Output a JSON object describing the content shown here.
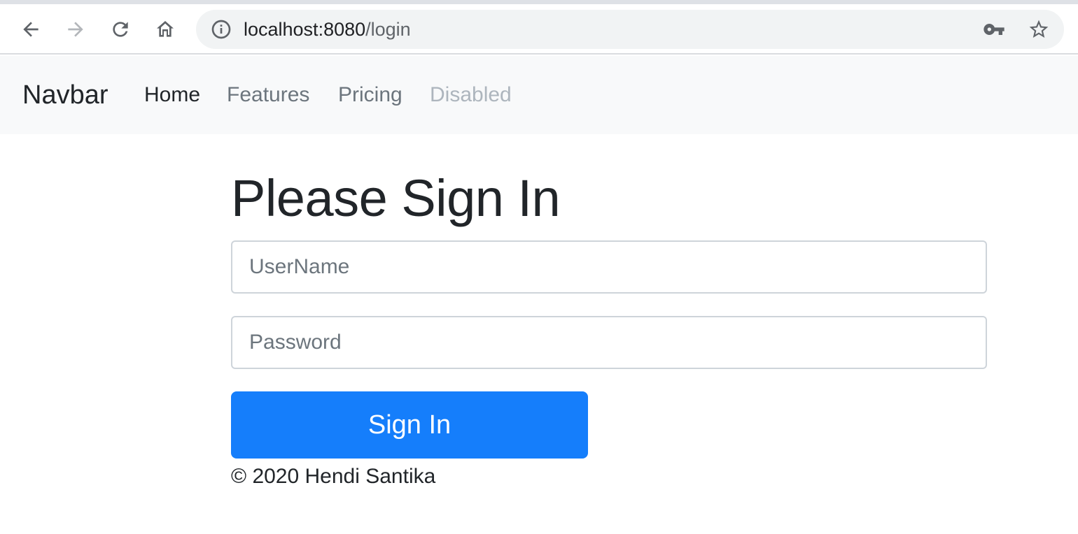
{
  "browser": {
    "url_host": "localhost:8080",
    "url_path": "/login",
    "icons": {
      "back": "arrow-left-icon",
      "forward": "arrow-right-icon",
      "reload": "reload-icon",
      "home": "home-icon",
      "site_info": "info-icon",
      "passwords": "key-icon",
      "bookmark": "star-icon"
    }
  },
  "navbar": {
    "brand": "Navbar",
    "links": [
      {
        "label": "Home",
        "state": "active"
      },
      {
        "label": "Features",
        "state": "normal"
      },
      {
        "label": "Pricing",
        "state": "normal"
      },
      {
        "label": "Disabled",
        "state": "disabled"
      }
    ]
  },
  "form": {
    "heading": "Please Sign In",
    "username": {
      "placeholder": "UserName",
      "value": ""
    },
    "password": {
      "placeholder": "Password",
      "value": ""
    },
    "submit_label": "Sign In"
  },
  "footer": {
    "text": "© 2020 Hendi Santika"
  },
  "colors": {
    "primary": "#157efb",
    "navbar_bg": "#f8f9fa",
    "text": "#212529",
    "muted": "#6c757d",
    "disabled": "#adb5bd"
  }
}
